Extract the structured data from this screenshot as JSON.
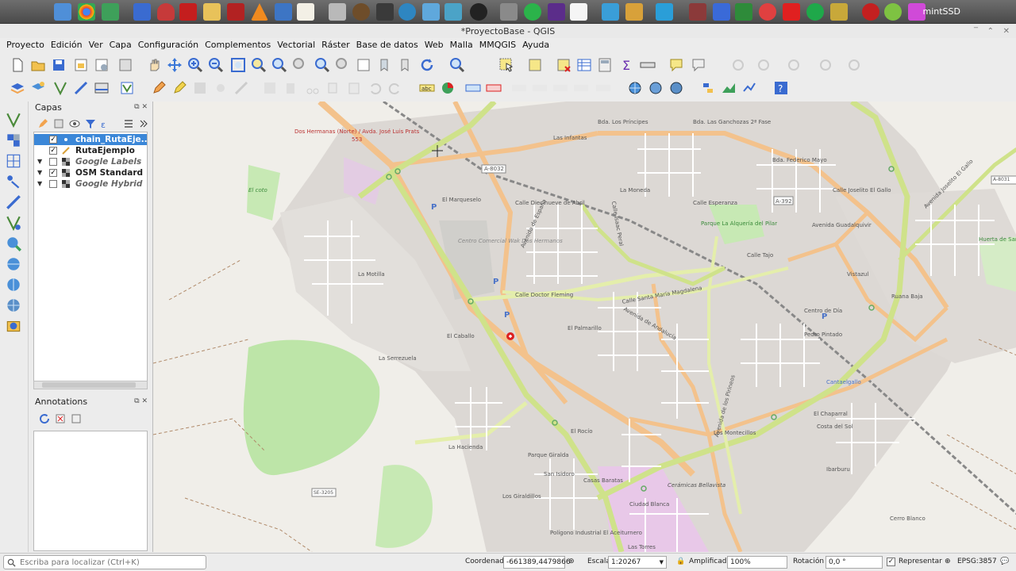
{
  "taskbar": {
    "user": "mintSSD"
  },
  "window": {
    "title": "*ProyectoBase - QGIS"
  },
  "menubar": {
    "items": [
      "Proyecto",
      "Edición",
      "Ver",
      "Capa",
      "Configuración",
      "Complementos",
      "Vectorial",
      "Ráster",
      "Base de datos",
      "Web",
      "Malla",
      "MMQGIS",
      "Ayuda"
    ]
  },
  "layers_panel": {
    "title": "Capas",
    "layers": [
      {
        "name": "chain_RutaEje...",
        "checked": true,
        "selected": true
      },
      {
        "name": "RutaEjemplo",
        "checked": true,
        "selected": false
      },
      {
        "name": "Google Labels",
        "checked": false,
        "selected": false
      },
      {
        "name": "OSM Standard",
        "checked": true,
        "selected": false
      },
      {
        "name": "Google Hybrid",
        "checked": false,
        "selected": false
      }
    ]
  },
  "annotations_panel": {
    "title": "Annotations"
  },
  "map": {
    "labels": [
      "Dos Hermanas (Norte) / Avda. José Luis Prats",
      "553",
      "A-8032",
      "Bda. Los Príncipes",
      "Bda. Las Ganchozas 2ª Fase",
      "Bda. Federico Mayo",
      "Las Infantas",
      "La Moneda",
      "El Marqueselo",
      "Centro Comercial Wak Dos Hermanos",
      "Avenida de España",
      "Calle Diecinueve de Abril",
      "Calle Isaac Peral",
      "Calle Esperanza",
      "Parque La Alquería del Pilar",
      "A-392",
      "Avenida Guadalquivir",
      "Calle Joselito El Gallo",
      "Avenida Joselito El Gallo",
      "Calle Tajo",
      "Vistazul",
      "Ruana Baja",
      "Huerta de San Hermenegildo",
      "La Motilla",
      "Calle Doctor Fleming",
      "Calle Santa María Magdalena",
      "Avenida de Andalucía",
      "El Palmarillo",
      "Avenida de los Pirineos",
      "Centro de Día",
      "Pedro Pintado",
      "El Caballo",
      "La Serrezuela",
      "Cantaelgallo",
      "El Chaparral",
      "Costa del Sol",
      "Los Montecillos",
      "El Rocío",
      "Parque Giralda",
      "San Isidoro",
      "Casas Baratas",
      "Los Giraldillos",
      "La Hacienda",
      "Ciudad Blanca",
      "Cerámicas Bellavista",
      "Polígono Industrial El Aceiturnero",
      "Las Torres",
      "Ibarburu",
      "Cerro Blanco",
      "SE-3205",
      "A-8031",
      "El coto"
    ]
  },
  "statusbar": {
    "locator_placeholder": "Escriba para localizar (Ctrl+K)",
    "coord_label": "Coordenada",
    "coord_value": "-661389,4479866",
    "scale_label": "Escala",
    "scale_value": "1:20267",
    "magnifier_label": "Amplificador",
    "magnifier_value": "100%",
    "rotation_label": "Rotación",
    "rotation_value": "0,0 °",
    "render_label": "Representar",
    "crs": "EPSG:3857"
  },
  "colors": {
    "selected_layer": "#3b87d8",
    "major_road": "#f3c28c",
    "trunk_road": "#cfe28a",
    "park": "#bde5a8",
    "urban": "#dcd8d4"
  }
}
